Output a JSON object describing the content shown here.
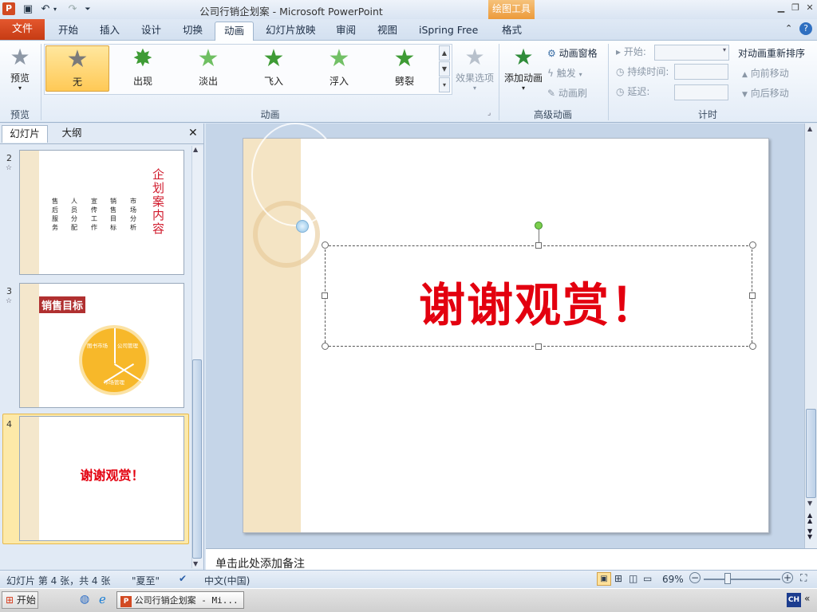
{
  "window": {
    "title": "公司行销企划案 - Microsoft PowerPoint",
    "context_tab": "绘图工具"
  },
  "tabs": {
    "file": "文件",
    "items": [
      "开始",
      "插入",
      "设计",
      "切换",
      "动画",
      "幻灯片放映",
      "审阅",
      "视图",
      "iSpring Free",
      "格式"
    ],
    "active": "动画"
  },
  "ribbon": {
    "preview": {
      "label": "预览",
      "group": "预览"
    },
    "animations": {
      "items": [
        "无",
        "出现",
        "淡出",
        "飞入",
        "浮入",
        "劈裂"
      ],
      "selected": "无",
      "effect_options": "效果选项",
      "group": "动画"
    },
    "advanced": {
      "add_animation": "添加动画",
      "animation_pane": "动画窗格",
      "trigger": "触发",
      "animation_painter": "动画刷",
      "group": "高级动画"
    },
    "timing": {
      "start": "开始:",
      "duration": "持续时间:",
      "delay": "延迟:",
      "reorder_title": "对动画重新排序",
      "move_earlier": "向前移动",
      "move_later": "向后移动",
      "group": "计时"
    }
  },
  "left_pane": {
    "tab_slides": "幻灯片",
    "tab_outline": "大纲",
    "slides": [
      {
        "number": "2",
        "title": "企划案内容",
        "bullets": [
          "市场分析",
          "销售目标",
          "宣传工作",
          "人员分配",
          "售后服务"
        ]
      },
      {
        "number": "3",
        "title": "销售目标",
        "segments": [
          "图书市场",
          "公司管理",
          "市场管理"
        ]
      },
      {
        "number": "4",
        "title": "谢谢观赏！"
      }
    ]
  },
  "slide": {
    "title": "谢谢观赏！"
  },
  "notes": {
    "placeholder": "单击此处添加备注"
  },
  "status": {
    "slide_info": "幻灯片 第 4 张，共 4 张",
    "theme": "\"夏至\"",
    "language": "中文(中国)",
    "zoom": "69%"
  },
  "taskbar": {
    "start": "开始",
    "window_item": "公司行销企划案 - Mi...",
    "ime": "CH"
  },
  "colors": {
    "accent_red": "#e3000f",
    "file_tab": "#d24a22",
    "selected_anim": "#ffd36b"
  }
}
